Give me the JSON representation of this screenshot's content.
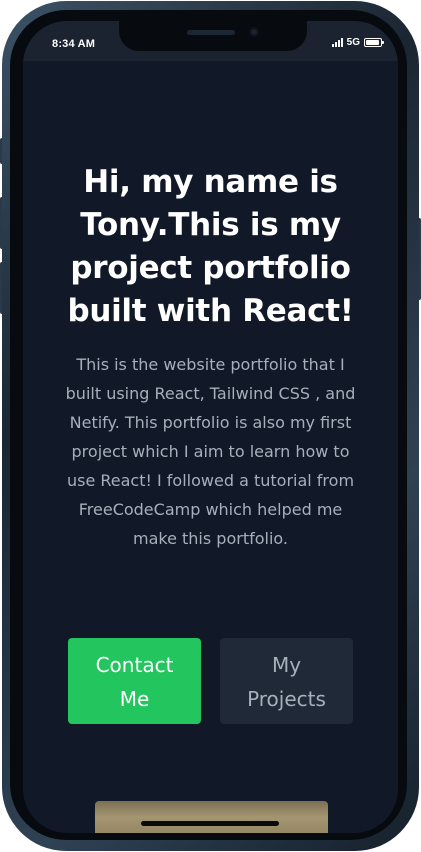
{
  "status_bar": {
    "time": "8:34 AM",
    "network": "5G",
    "battery_level": 0.9
  },
  "hero": {
    "title": "Hi, my name is Tony.This is my project portfolio built with React!",
    "description": "This is the website portfolio that I built using React, Tailwind CSS , and Netify. This portfolio is also my first project which I aim to learn how to use React! I followed a tutorial from FreeCodeCamp which helped me make this portfolio.",
    "buttons": {
      "contact_label": "Contact Me",
      "projects_label": "My Projects"
    }
  },
  "icons": {
    "signal": "cellular-signal-icon",
    "battery": "battery-icon"
  },
  "colors": {
    "background": "#111827",
    "accent": "#22c55e",
    "secondary_button": "#1f2937",
    "body_text": "#a7afbb"
  }
}
